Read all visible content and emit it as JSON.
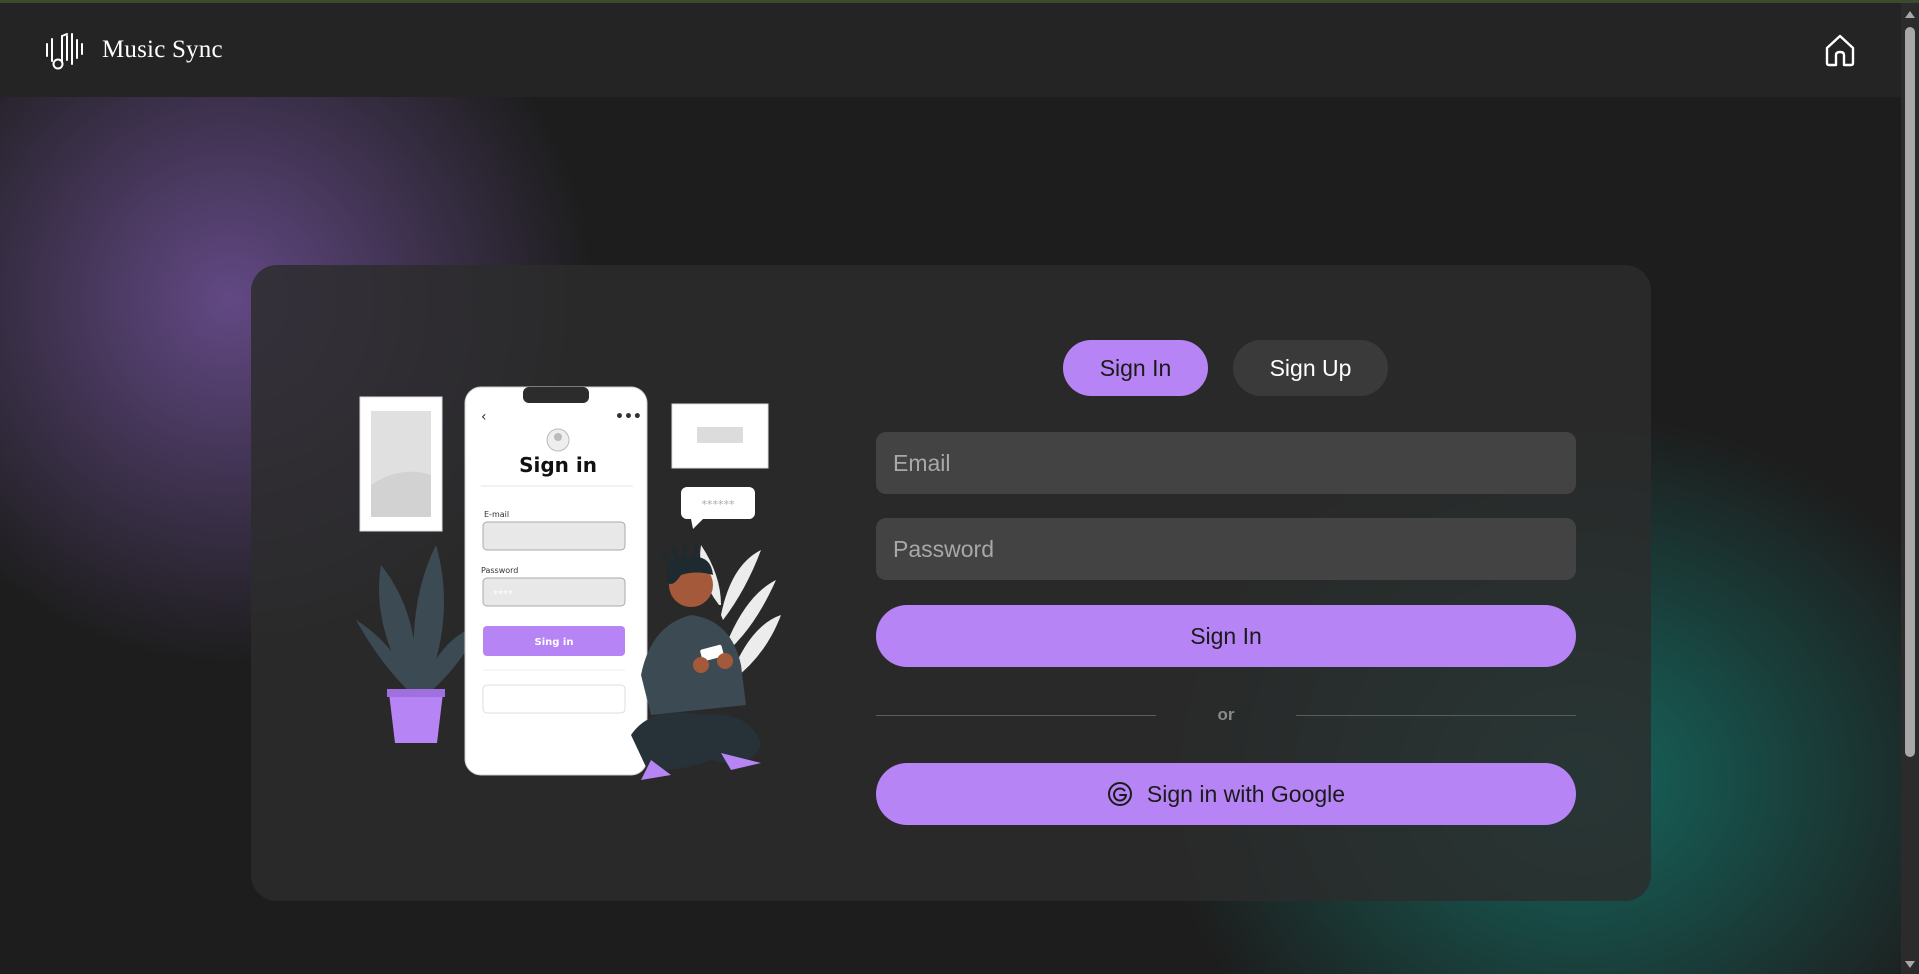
{
  "app": {
    "brand_name": "Music Sync",
    "brand_icon": "music-note-waveform-icon",
    "home_icon": "home-icon"
  },
  "auth": {
    "tabs": [
      {
        "label": "Sign In",
        "active": true
      },
      {
        "label": "Sign Up",
        "active": false
      }
    ],
    "email_placeholder": "Email",
    "password_placeholder": "Password",
    "submit_label": "Sign In",
    "divider_text": "or",
    "google_label": "Sign in with Google",
    "google_icon": "google-g-icon"
  },
  "illustration": {
    "phone_title": "Sign in",
    "email_label": "E-mail",
    "password_label": "Password",
    "password_mask": "****",
    "button_label": "Sing in",
    "bubble_text": "******"
  },
  "colors": {
    "accent": "#b784f5",
    "header_bg": "#242424",
    "card_bg": "#2c2c2c",
    "input_bg": "#434343"
  }
}
